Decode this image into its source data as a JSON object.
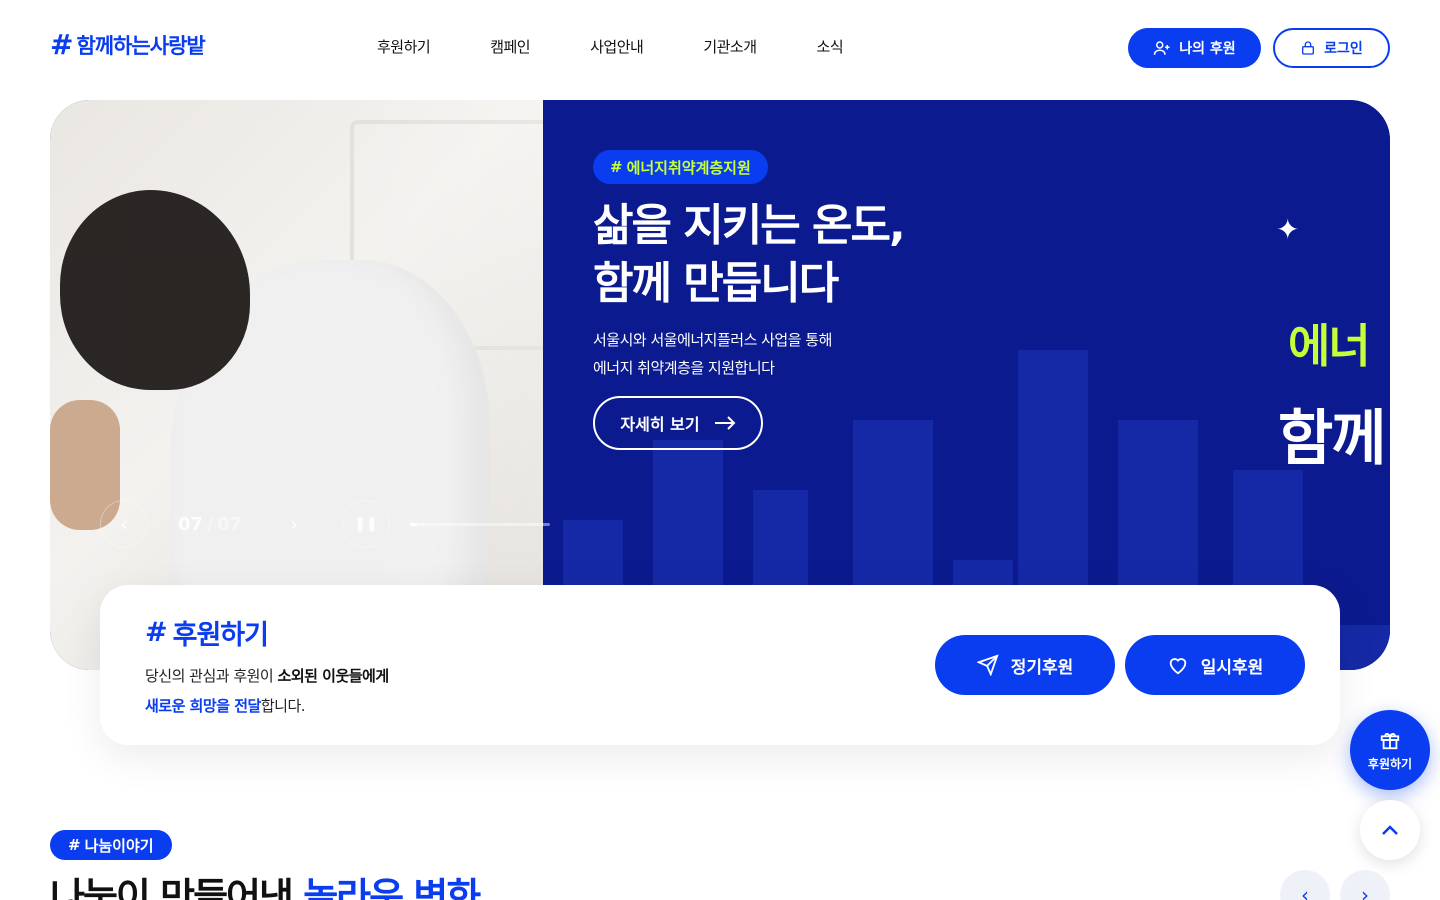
{
  "header": {
    "logo_text": "함께하는사랑밭",
    "nav": [
      "후원하기",
      "캠페인",
      "사업안내",
      "기관소개",
      "소식"
    ],
    "my_donation_label": "나의 후원",
    "login_label": "로그인"
  },
  "hero": {
    "tag": "에너지취약계층지원",
    "title_line1": "삶을 지키는 온도,",
    "title_line2": "함께 만듭니다",
    "desc_line1": "서울시와 서울에너지플러스 사업을 통해",
    "desc_line2": "에너지 취약계층을 지원합니다",
    "more_label": "자세히 보기",
    "brand_partial1": "에너",
    "brand_partial2": "함께",
    "slide_current": "07",
    "slide_separator": "/",
    "slide_total": "07",
    "progress_fraction": 0.05
  },
  "donate": {
    "title": "후원하기",
    "desc_part1": "당신의 관심과 후원이 ",
    "desc_bold": "소외된 이웃들에게",
    "desc_hl": "새로운 희망을 전달",
    "desc_part2": "합니다.",
    "regular_label": "정기후원",
    "once_label": "일시후원"
  },
  "floating": {
    "donate_label": "후원하기"
  },
  "story": {
    "tag": "나눔이야기",
    "title_plain": "나눔이 만들어낸 ",
    "title_blue": "놀라운 변화"
  },
  "colors": {
    "brand_blue": "#0a3cf0",
    "hero_navy": "#0b1a8e",
    "accent_lime": "#c6ff3a"
  }
}
